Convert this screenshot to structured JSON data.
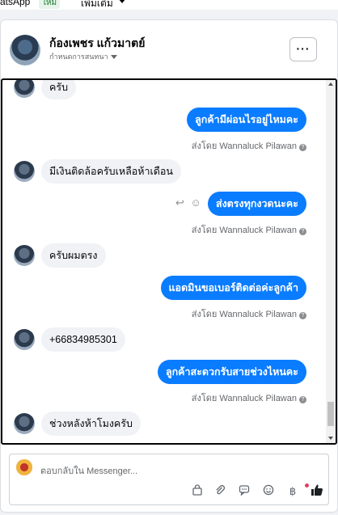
{
  "topbar": {
    "fragment": "atsApp",
    "badge": "ใหม่",
    "more": "เพิ่มเติม"
  },
  "header": {
    "name": "ก้องเพชร แก้วมาตย์",
    "subtitle": "กำหนดการสนทนา",
    "menu": "···"
  },
  "messages": [
    {
      "dir": "in",
      "text": "ครับ"
    },
    {
      "dir": "out",
      "text": "ลูกค้ามีผ่อนไรอยู่ไหมคะ",
      "sent_by": "ส่งโดย Wannaluck Pilawan"
    },
    {
      "dir": "in",
      "text": "มีเงินติดล้อครับเหลือห้าเดือน"
    },
    {
      "dir": "out",
      "text": "ส่งตรงทุกงวดนะคะ",
      "sent_by": "ส่งโดย Wannaluck Pilawan"
    },
    {
      "dir": "in",
      "text": "ครับผมตรง"
    },
    {
      "dir": "out",
      "text": "แอดมินขอเบอร์ติดต่อค่ะลูกค้า",
      "sent_by": "ส่งโดย Wannaluck Pilawan"
    },
    {
      "dir": "in",
      "text": "+66834985301"
    },
    {
      "dir": "out",
      "text": "ลูกค้าสะดวกรับสายช่วงไหนคะ",
      "sent_by": "ส่งโดย Wannaluck Pilawan"
    },
    {
      "dir": "in",
      "text": "ช่วงหลังห้าโมงครับ"
    }
  ],
  "composer": {
    "placeholder": "ตอบกลับใน Messenger..."
  },
  "icons": {
    "reply": "reply-icon",
    "react": "smile-icon",
    "info": "question-icon",
    "tools": [
      "shopping-bag-icon",
      "paperclip-icon",
      "chat-bubbles-icon",
      "emoji-icon",
      "baht-icon",
      "thumbs-up-icon"
    ]
  },
  "colors": {
    "accent": "#0a7cff",
    "incoming": "#f0f2f5",
    "notification": "#e4405f"
  }
}
